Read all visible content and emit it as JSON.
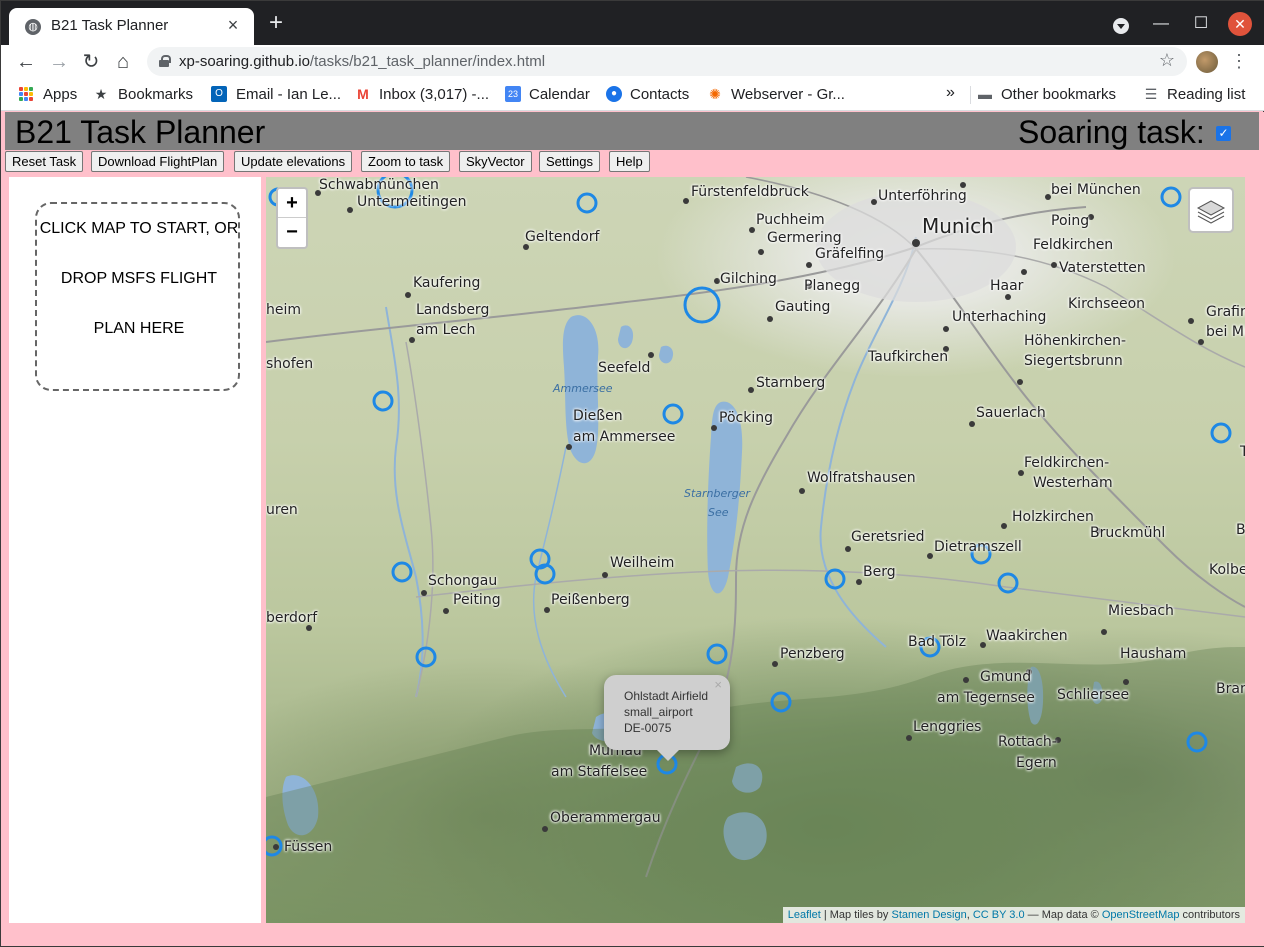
{
  "browser": {
    "tab_title": "B21 Task Planner",
    "url_host": "xp-soaring.github.io",
    "url_path": "/tasks/b21_task_planner/index.html",
    "bookmarks": [
      {
        "label": "Apps",
        "icon": "apps-grid-icon"
      },
      {
        "label": "Bookmarks",
        "icon": "star-icon"
      },
      {
        "label": "Email - Ian Le...",
        "icon": "outlook-icon"
      },
      {
        "label": "Inbox (3,017) -...",
        "icon": "gmail-icon"
      },
      {
        "label": "Calendar",
        "icon": "calendar-icon"
      },
      {
        "label": "Contacts",
        "icon": "contacts-icon"
      },
      {
        "label": "Webserver - Gr...",
        "icon": "grafana-icon"
      }
    ],
    "overflow_label": "»",
    "other_bookmarks": "Other bookmarks",
    "reading_list": "Reading list"
  },
  "app": {
    "title": "B21 Task Planner",
    "soaring_task_label": "Soaring task:",
    "soaring_task_checked": true,
    "buttons": [
      "Reset Task",
      "Download FlightPlan",
      "Update elevations",
      "Zoom to task",
      "SkyVector",
      "Settings",
      "Help"
    ],
    "drop_zone": [
      "CLICK MAP TO START, OR",
      "DROP MSFS FLIGHT",
      "PLAN HERE"
    ]
  },
  "map": {
    "zoom_in": "+",
    "zoom_out": "−",
    "places": [
      {
        "name": "Schwabmünchen"
      },
      {
        "name": "Untermeitingen"
      },
      {
        "name": "Fürstenfeldbruck"
      },
      {
        "name": "Unterföhring"
      },
      {
        "name": "bei München"
      },
      {
        "name": "Puchheim"
      },
      {
        "name": "Germering"
      },
      {
        "name": "Gräfelfing"
      },
      {
        "name": "Munich"
      },
      {
        "name": "Poing"
      },
      {
        "name": "Geltendorf"
      },
      {
        "name": "Feldkirchen"
      },
      {
        "name": "Kaufering"
      },
      {
        "name": "Gilching"
      },
      {
        "name": "Planegg"
      },
      {
        "name": "Vaterstetten"
      },
      {
        "name": "Haar"
      },
      {
        "name": "Landsberg"
      },
      {
        "name": "am Lech"
      },
      {
        "name": "Gauting"
      },
      {
        "name": "Kirchseeon"
      },
      {
        "name": "Grafing"
      },
      {
        "name": "bei Mü"
      },
      {
        "name": "heim"
      },
      {
        "name": "Unterhaching"
      },
      {
        "name": "Höhenkirchen-"
      },
      {
        "name": "Siegertsbrunn"
      },
      {
        "name": "Taufkirchen"
      },
      {
        "name": "shofen"
      },
      {
        "name": "Seefeld"
      },
      {
        "name": "Starnberg"
      },
      {
        "name": "Sauerlach"
      },
      {
        "name": "Dießen"
      },
      {
        "name": "am Ammersee"
      },
      {
        "name": "Pöcking"
      },
      {
        "name": "Wolfratshausen"
      },
      {
        "name": "Feldkirchen-"
      },
      {
        "name": "Westerham"
      },
      {
        "name": "uren"
      },
      {
        "name": "Holzkirchen"
      },
      {
        "name": "Bruckmühl"
      },
      {
        "name": "Geretsried"
      },
      {
        "name": "Dietramszell"
      },
      {
        "name": "Weilheim"
      },
      {
        "name": "Schongau"
      },
      {
        "name": "Peiting"
      },
      {
        "name": "Berg"
      },
      {
        "name": "Kolberm"
      },
      {
        "name": "Peißenberg"
      },
      {
        "name": "berdorf"
      },
      {
        "name": "Miesbach"
      },
      {
        "name": "Bad Tölz"
      },
      {
        "name": "Waakirchen"
      },
      {
        "name": "Penzberg"
      },
      {
        "name": "Hausham"
      },
      {
        "name": "Gmund"
      },
      {
        "name": "am Tegernsee"
      },
      {
        "name": "Schliersee"
      },
      {
        "name": "Brann"
      },
      {
        "name": "Lenggries"
      },
      {
        "name": "Rottach-"
      },
      {
        "name": "Egern"
      },
      {
        "name": "Murnau"
      },
      {
        "name": "am Staffelsee"
      },
      {
        "name": "Oberammergau"
      },
      {
        "name": "Füssen"
      },
      {
        "name": "B"
      },
      {
        "name": "T"
      }
    ],
    "water_labels": [
      "Ammersee",
      "Starnberger",
      "See"
    ],
    "popup": {
      "name": "Ohlstadt Airfield",
      "type": "small_airport",
      "ident": "DE-0075",
      "close": "×"
    },
    "attribution": {
      "leaflet": "Leaflet",
      "sep1": " | Map tiles by ",
      "stamen": "Stamen Design",
      "sep2": ", ",
      "license": "CC BY 3.0",
      "sep3": " — Map data © ",
      "osm": "OpenStreetMap",
      "tail": " contributors"
    },
    "colors": {
      "airport_marker": "#1e88e5",
      "water": "#8fb4d8",
      "page_bg": "#ffc0cb",
      "header_bg": "#808080"
    }
  }
}
